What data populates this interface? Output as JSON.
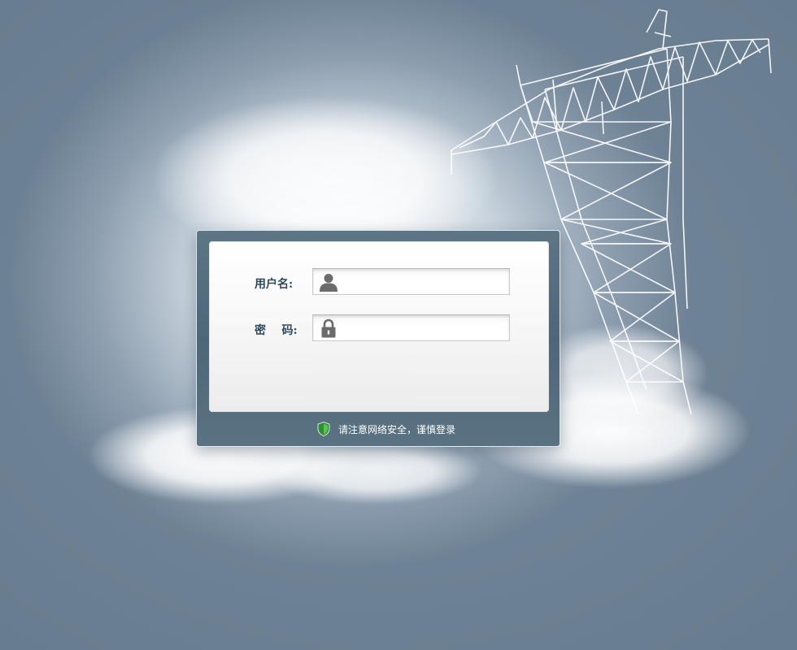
{
  "login": {
    "username_label": "用户名:",
    "password_label": "密    码:",
    "username_value": "",
    "password_value": "",
    "username_icon": "user-icon",
    "password_icon": "lock-icon"
  },
  "notice": {
    "icon": "shield-icon",
    "text": "请注意网络安全，谨慎登录"
  },
  "colors": {
    "frame": "#5a7282",
    "label": "#2e4a5e",
    "background": "#8e9fb0",
    "shield": "#3aa33a"
  }
}
